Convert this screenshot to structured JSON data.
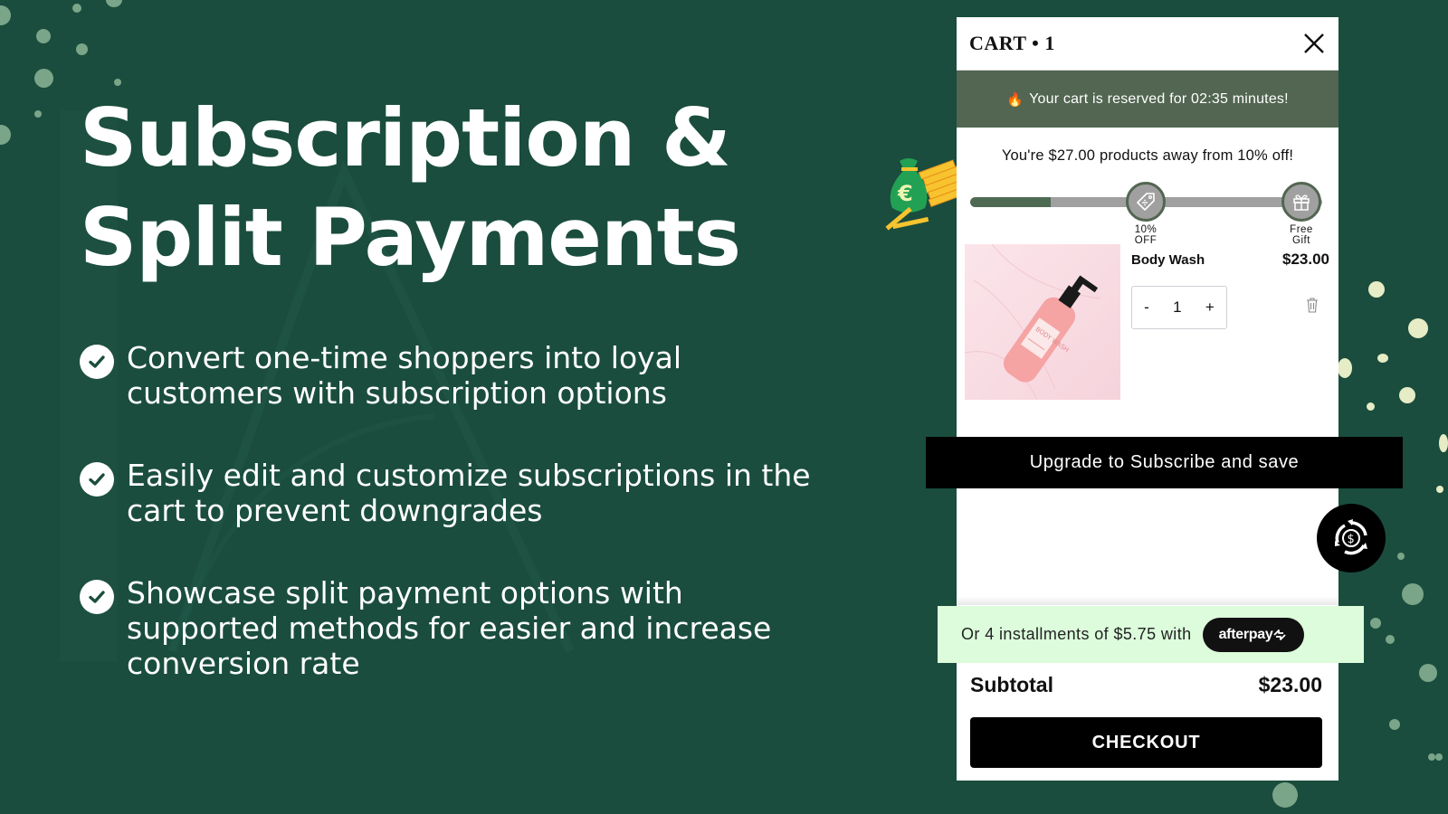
{
  "hero": {
    "headline_line1": "Subscription &",
    "headline_line2": "Split Payments",
    "features": [
      {
        "icon": "check-circle-icon",
        "text": "Convert one-time shoppers into loyal customers with subscription options"
      },
      {
        "icon": "check-circle-icon",
        "text": "Easily edit and customize subscriptions in the cart to prevent downgrades"
      },
      {
        "icon": "check-circle-icon",
        "text": "Showcase split payment options with supported methods for easier and increase conversion rate"
      }
    ]
  },
  "cart": {
    "title": "CART • 1",
    "close_icon": "close-icon",
    "reservation": {
      "icon": "fire-icon",
      "icon_glyph": "🔥",
      "text": "Your cart is reserved for 02:35 minutes!"
    },
    "goal_message": "You're $27.00 products away from 10% off!",
    "progress": {
      "fill_fraction": 0.23,
      "milestones": [
        {
          "icon": "discount-tag-icon",
          "label_line1": "10%",
          "label_line2": "OFF"
        },
        {
          "icon": "gift-icon",
          "label_line1": "Free",
          "label_line2": "Gift"
        }
      ]
    },
    "item": {
      "name": "Body Wash",
      "price": "$23.00",
      "image_label": "BODY WASH",
      "quantity": "1",
      "decrement": "-",
      "increment": "+"
    },
    "upgrade_button": "Upgrade to Subscribe and save",
    "afterpay": {
      "text": "Or 4 installments of $5.75 with",
      "brand": "afterpay"
    },
    "subtotal_label": "Subtotal",
    "subtotal_value": "$23.00",
    "checkout_button": "CHECKOUT"
  },
  "colors": {
    "background": "#1a4d3d",
    "reserve_banner": "#526651",
    "progress_fill": "#4f6a52",
    "afterpay_bg": "#dcfcdc",
    "button": "#000000"
  }
}
